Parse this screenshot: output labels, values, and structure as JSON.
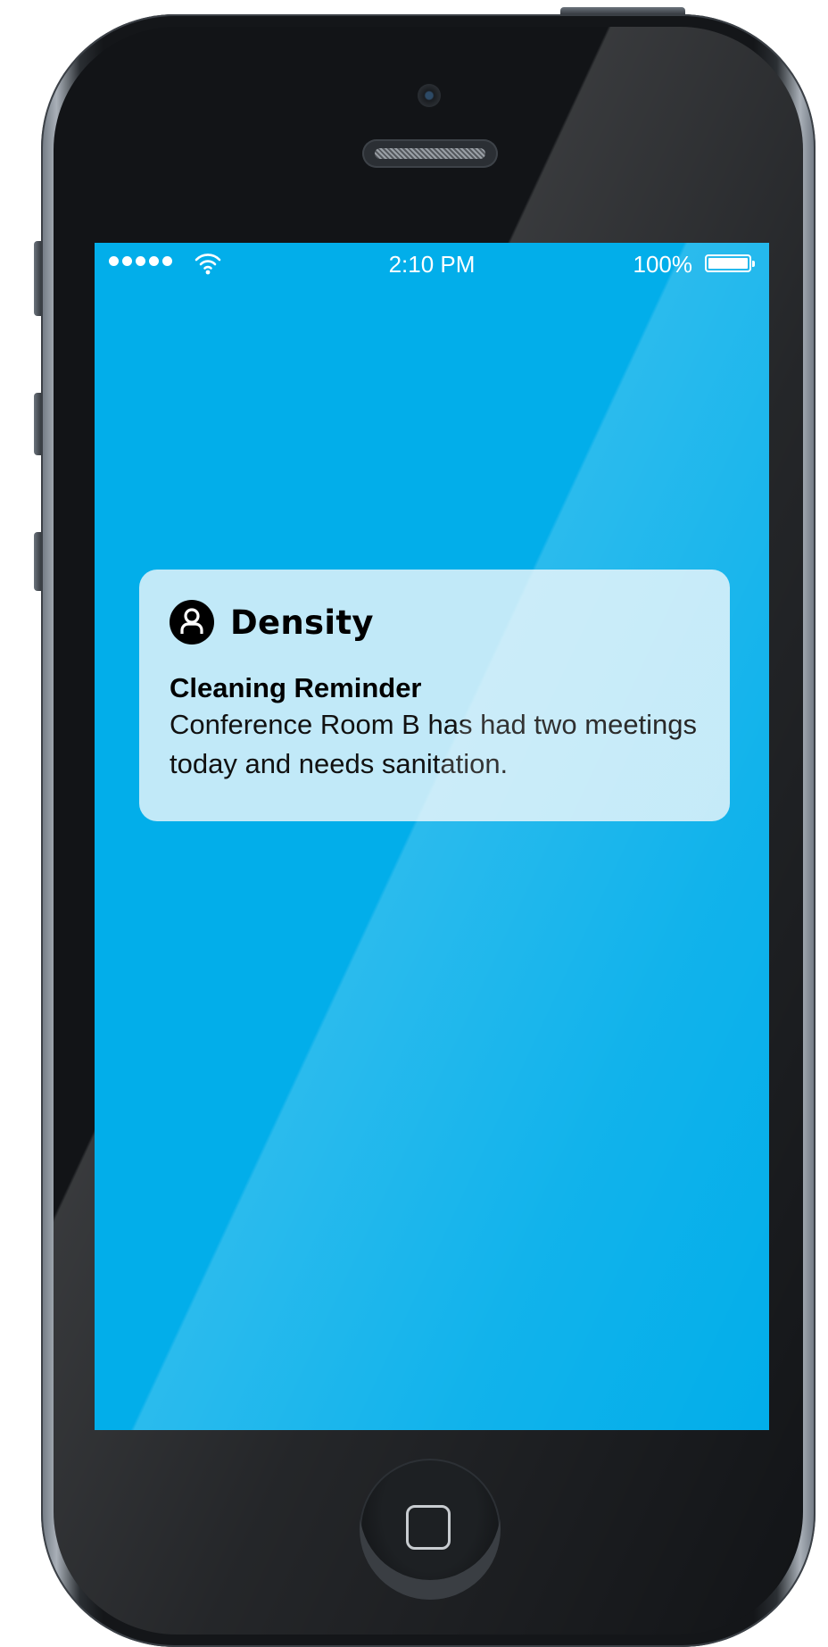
{
  "status_bar": {
    "signal_bars": 5,
    "wifi_icon": "wifi-icon",
    "time": "2:10 PM",
    "battery_percent": "100%",
    "battery_level": 1.0
  },
  "notification": {
    "app_icon": "user-circle-icon",
    "app_name": "Density",
    "title": "Cleaning Reminder",
    "body": "Conference Room B has had two meetings today and needs sanitation."
  },
  "colors": {
    "screen_background": "#02aeea",
    "notification_background": "#c1e9f8",
    "phone_body": "#121417"
  },
  "device": {
    "home_button_icon": "home-square-icon"
  }
}
